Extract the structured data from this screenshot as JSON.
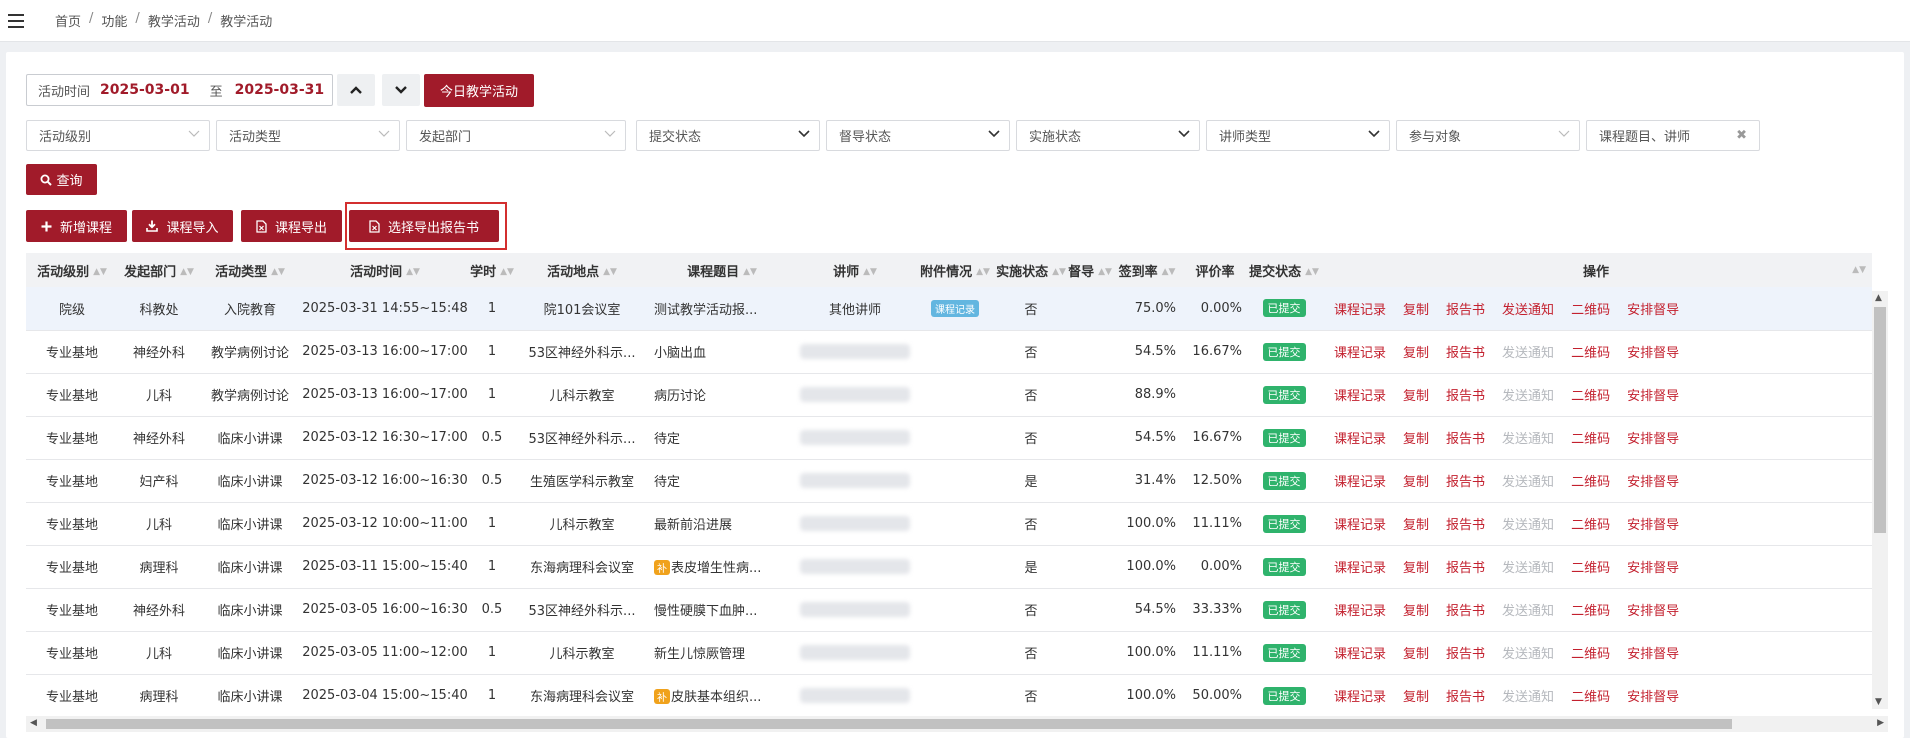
{
  "breadcrumb": [
    "首页",
    "功能",
    "教学活动",
    "教学活动"
  ],
  "date_range": {
    "label": "活动时间",
    "start": "2025-03-01",
    "to": "至",
    "end": "2025-03-31"
  },
  "today_button": "今日教学活动",
  "filters": {
    "level": "活动级别",
    "type": "活动类型",
    "dept": "发起部门",
    "submit_status": "提交状态",
    "supervise_status": "督导状态",
    "impl_status": "实施状态",
    "lecturer_type": "讲师类型",
    "participants": "参与对象",
    "search": "课程题目、讲师"
  },
  "query_button": "查询",
  "actions": {
    "add": "新增课程",
    "import": "课程导入",
    "export": "课程导出",
    "export_report": "选择导出报告书"
  },
  "columns": [
    "活动级别",
    "发起部门",
    "活动类型",
    "活动时间",
    "学时",
    "活动地点",
    "课程题目",
    "讲师",
    "附件情况",
    "实施状态",
    "督导",
    "签到率",
    "评价率",
    "提交状态",
    "操作"
  ],
  "ops": [
    "课程记录",
    "复制",
    "报告书",
    "发送通知",
    "二维码",
    "安排督导"
  ],
  "rows": [
    {
      "level": "院级",
      "dept": "科教处",
      "type": "入院教育",
      "time": "2025-03-31  14:55~15:48",
      "hours": "1",
      "place": "院101会议室",
      "topic": "测试教学活动报...",
      "bu": "",
      "lecturer": "其他讲师",
      "attach": "课程记录",
      "impl": "否",
      "sup": "",
      "sign": "75.0%",
      "eval": "0.00%",
      "status": "已提交"
    },
    {
      "level": "专业基地",
      "dept": "神经外科",
      "type": "教学病例讨论",
      "time": "2025-03-13  16:00~17:00",
      "hours": "1",
      "place": "53区神经外科示...",
      "topic": "小脑出血",
      "bu": "",
      "lecturer": "",
      "attach": "",
      "impl": "否",
      "sup": "",
      "sign": "54.5%",
      "eval": "16.67%",
      "status": "已提交"
    },
    {
      "level": "专业基地",
      "dept": "儿科",
      "type": "教学病例讨论",
      "time": "2025-03-13  16:00~17:00",
      "hours": "1",
      "place": "儿科示教室",
      "topic": "病历讨论",
      "bu": "",
      "lecturer": "",
      "attach": "",
      "impl": "否",
      "sup": "",
      "sign": "88.9%",
      "eval": "",
      "status": "已提交"
    },
    {
      "level": "专业基地",
      "dept": "神经外科",
      "type": "临床小讲课",
      "time": "2025-03-12  16:30~17:00",
      "hours": "0.5",
      "place": "53区神经外科示...",
      "topic": "待定",
      "bu": "",
      "lecturer": "",
      "attach": "",
      "impl": "否",
      "sup": "",
      "sign": "54.5%",
      "eval": "16.67%",
      "status": "已提交"
    },
    {
      "level": "专业基地",
      "dept": "妇产科",
      "type": "临床小讲课",
      "time": "2025-03-12  16:00~16:30",
      "hours": "0.5",
      "place": "生殖医学科示教室",
      "topic": "待定",
      "bu": "",
      "lecturer": "",
      "attach": "",
      "impl": "是",
      "sup": "",
      "sign": "31.4%",
      "eval": "12.50%",
      "status": "已提交"
    },
    {
      "level": "专业基地",
      "dept": "儿科",
      "type": "临床小讲课",
      "time": "2025-03-12  10:00~11:00",
      "hours": "1",
      "place": "儿科示教室",
      "topic": "最新前沿进展",
      "bu": "",
      "lecturer": "",
      "attach": "",
      "impl": "否",
      "sup": "",
      "sign": "100.0%",
      "eval": "11.11%",
      "status": "已提交"
    },
    {
      "level": "专业基地",
      "dept": "病理科",
      "type": "临床小讲课",
      "time": "2025-03-11  15:00~15:40",
      "hours": "1",
      "place": "东海病理科会议室",
      "topic": "表皮增生性病...",
      "bu": "补",
      "lecturer": "",
      "attach": "",
      "impl": "是",
      "sup": "",
      "sign": "100.0%",
      "eval": "0.00%",
      "status": "已提交"
    },
    {
      "level": "专业基地",
      "dept": "神经外科",
      "type": "临床小讲课",
      "time": "2025-03-05  16:00~16:30",
      "hours": "0.5",
      "place": "53区神经外科示...",
      "topic": "慢性硬膜下血肿...",
      "bu": "",
      "lecturer": "",
      "attach": "",
      "impl": "否",
      "sup": "",
      "sign": "54.5%",
      "eval": "33.33%",
      "status": "已提交"
    },
    {
      "level": "专业基地",
      "dept": "儿科",
      "type": "临床小讲课",
      "time": "2025-03-05  11:00~12:00",
      "hours": "1",
      "place": "儿科示教室",
      "topic": "新生儿惊厥管理",
      "bu": "",
      "lecturer": "",
      "attach": "",
      "impl": "否",
      "sup": "",
      "sign": "100.0%",
      "eval": "11.11%",
      "status": "已提交"
    },
    {
      "level": "专业基地",
      "dept": "病理科",
      "type": "临床小讲课",
      "time": "2025-03-04  15:00~15:40",
      "hours": "1",
      "place": "东海病理科会议室",
      "topic": "皮肤基本组织...",
      "bu": "补",
      "lecturer": "",
      "attach": "",
      "impl": "否",
      "sup": "",
      "sign": "100.0%",
      "eval": "50.00%",
      "status": "已提交"
    }
  ]
}
